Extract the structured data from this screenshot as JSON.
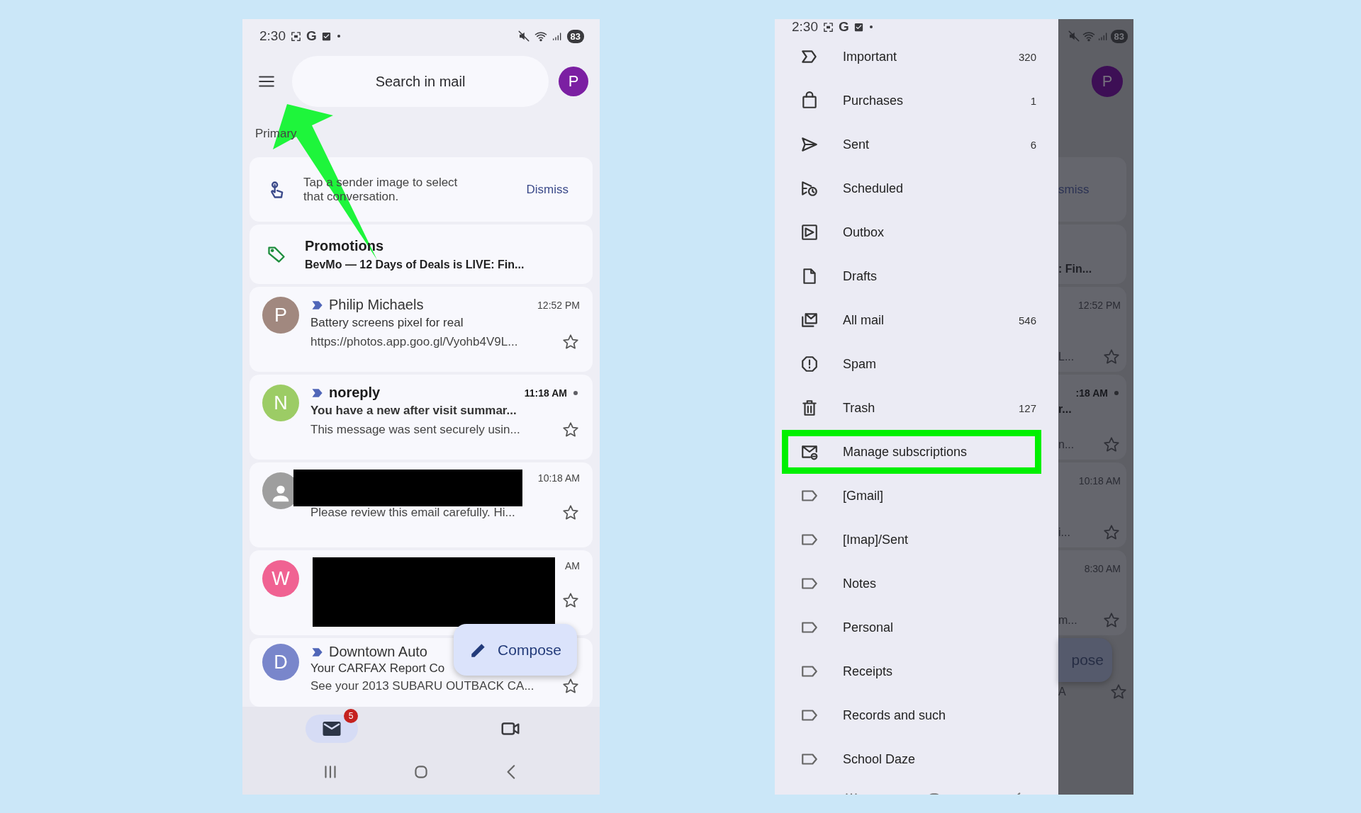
{
  "left_screen": {
    "status_bar": {
      "time": "2:30",
      "app_letter": "G",
      "battery": "83"
    },
    "search": {
      "placeholder": "Search in mail"
    },
    "account_initial": "P",
    "section": "Primary",
    "tip": {
      "text": "Tap a sender image to select that conversation.",
      "action": "Dismiss"
    },
    "promotions": {
      "title": "Promotions",
      "snippet": "BevMo — 12 Days of Deals is LIVE: Fin..."
    },
    "emails": [
      {
        "kind": "letter",
        "initial": "P",
        "color": "#a1887f",
        "sender": "Philip Michaels",
        "important": true,
        "unread": false,
        "time": "12:52 PM",
        "subject": "Battery screens pixel for real",
        "snippet": "https://photos.app.goo.gl/Vyohb4V9L...",
        "starred": false
      },
      {
        "kind": "letter",
        "initial": "N",
        "color": "#9ccc65",
        "sender": "noreply",
        "important": true,
        "unread": true,
        "time": "11:18 AM",
        "subject": "You have a new after visit summar...",
        "snippet": "This message was sent securely usin...",
        "starred": false
      },
      {
        "kind": "person",
        "color": "#9e9e9e",
        "redacted": true,
        "time": "10:18 AM",
        "snippet": "Please review this email carefully. Hi...",
        "starred": false
      },
      {
        "kind": "letter",
        "initial": "W",
        "color": "#f06292",
        "redacted": true,
        "time": "AM",
        "starred": false
      },
      {
        "kind": "letter",
        "initial": "D",
        "color": "#7986cb",
        "sender": "Downtown Auto",
        "important": true,
        "unread": false,
        "subject": "Your CARFAX Report Co",
        "snippet": "See your 2013 SUBARU OUTBACK CA...",
        "starred": false
      }
    ],
    "compose": {
      "label": "Compose"
    },
    "bottom_nav": [
      {
        "kind": "mail",
        "badge": "5",
        "selected": true
      },
      {
        "kind": "meet",
        "selected": false
      }
    ]
  },
  "right_screen": {
    "status_bar": {
      "time": "2:30",
      "app_letter": "G",
      "battery": "83"
    },
    "drawer": [
      {
        "kind": "important",
        "label": "Important",
        "count": "320",
        "selected": false,
        "highlighted": false
      },
      {
        "kind": "purchases",
        "label": "Purchases",
        "count": "1",
        "selected": false,
        "highlighted": false
      },
      {
        "kind": "sent",
        "label": "Sent",
        "count": "6",
        "selected": false,
        "highlighted": false
      },
      {
        "kind": "scheduled",
        "label": "Scheduled",
        "selected": false,
        "highlighted": false
      },
      {
        "kind": "outbox",
        "label": "Outbox",
        "selected": false,
        "highlighted": false
      },
      {
        "kind": "drafts",
        "label": "Drafts",
        "selected": false,
        "highlighted": false
      },
      {
        "kind": "allmail",
        "label": "All mail",
        "count": "546",
        "selected": false,
        "highlighted": false
      },
      {
        "kind": "spam",
        "label": "Spam",
        "selected": false,
        "highlighted": false
      },
      {
        "kind": "trash",
        "label": "Trash",
        "count": "127",
        "selected": false,
        "highlighted": false
      },
      {
        "kind": "subscriptions",
        "label": "Manage subscriptions",
        "selected": false,
        "highlighted": true
      },
      {
        "kind": "label",
        "label": "[Gmail]",
        "selected": false,
        "highlighted": false
      },
      {
        "kind": "label",
        "label": "[Imap]/Sent",
        "selected": false,
        "highlighted": false
      },
      {
        "kind": "label",
        "label": "Notes",
        "selected": false,
        "highlighted": false
      },
      {
        "kind": "label",
        "label": "Personal",
        "selected": false,
        "highlighted": false
      },
      {
        "kind": "label",
        "label": "Receipts",
        "selected": false,
        "highlighted": false
      },
      {
        "kind": "label",
        "label": "Records and such",
        "selected": false,
        "highlighted": false
      },
      {
        "kind": "label",
        "label": "School Daze",
        "selected": false,
        "highlighted": false
      }
    ],
    "behind_drawer": {
      "account_initial": "P",
      "tip_action": "smiss",
      "promo_snippet": ": Fin...",
      "rows": [
        {
          "time": "12:52 PM",
          "snippet": "L...",
          "unread": false,
          "starred": false
        },
        {
          "time": ":18 AM",
          "subject": "r...",
          "snippet": "n...",
          "unread": true,
          "starred": false
        },
        {
          "time": "10:18 AM",
          "snippet": "i...",
          "unread": false,
          "starred": false
        },
        {
          "time": "8:30 AM",
          "snippet": "m...",
          "unread": false,
          "starred": false
        },
        {
          "snippet": "A",
          "starred": false
        }
      ],
      "compose_label": "pose"
    }
  }
}
